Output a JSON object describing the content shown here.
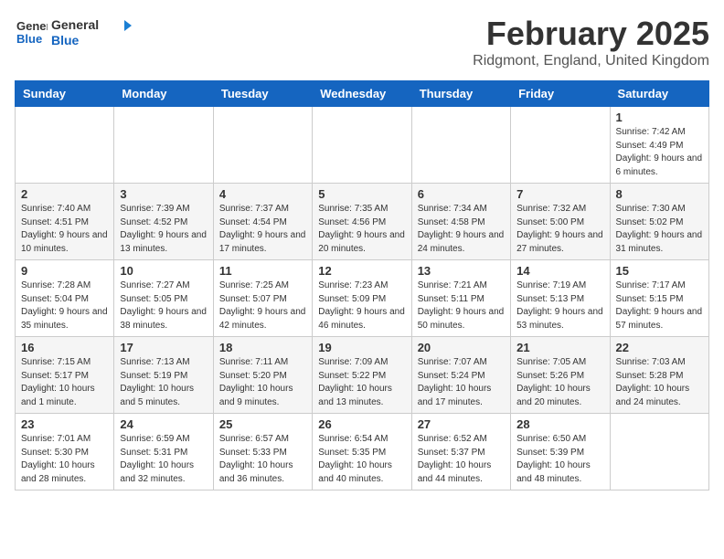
{
  "header": {
    "logo": {
      "line1": "General",
      "line2": "Blue"
    },
    "title": "February 2025",
    "subtitle": "Ridgmont, England, United Kingdom"
  },
  "weekdays": [
    "Sunday",
    "Monday",
    "Tuesday",
    "Wednesday",
    "Thursday",
    "Friday",
    "Saturday"
  ],
  "weeks": [
    [
      {
        "day": "",
        "info": ""
      },
      {
        "day": "",
        "info": ""
      },
      {
        "day": "",
        "info": ""
      },
      {
        "day": "",
        "info": ""
      },
      {
        "day": "",
        "info": ""
      },
      {
        "day": "",
        "info": ""
      },
      {
        "day": "1",
        "info": "Sunrise: 7:42 AM\nSunset: 4:49 PM\nDaylight: 9 hours and 6 minutes."
      }
    ],
    [
      {
        "day": "2",
        "info": "Sunrise: 7:40 AM\nSunset: 4:51 PM\nDaylight: 9 hours and 10 minutes."
      },
      {
        "day": "3",
        "info": "Sunrise: 7:39 AM\nSunset: 4:52 PM\nDaylight: 9 hours and 13 minutes."
      },
      {
        "day": "4",
        "info": "Sunrise: 7:37 AM\nSunset: 4:54 PM\nDaylight: 9 hours and 17 minutes."
      },
      {
        "day": "5",
        "info": "Sunrise: 7:35 AM\nSunset: 4:56 PM\nDaylight: 9 hours and 20 minutes."
      },
      {
        "day": "6",
        "info": "Sunrise: 7:34 AM\nSunset: 4:58 PM\nDaylight: 9 hours and 24 minutes."
      },
      {
        "day": "7",
        "info": "Sunrise: 7:32 AM\nSunset: 5:00 PM\nDaylight: 9 hours and 27 minutes."
      },
      {
        "day": "8",
        "info": "Sunrise: 7:30 AM\nSunset: 5:02 PM\nDaylight: 9 hours and 31 minutes."
      }
    ],
    [
      {
        "day": "9",
        "info": "Sunrise: 7:28 AM\nSunset: 5:04 PM\nDaylight: 9 hours and 35 minutes."
      },
      {
        "day": "10",
        "info": "Sunrise: 7:27 AM\nSunset: 5:05 PM\nDaylight: 9 hours and 38 minutes."
      },
      {
        "day": "11",
        "info": "Sunrise: 7:25 AM\nSunset: 5:07 PM\nDaylight: 9 hours and 42 minutes."
      },
      {
        "day": "12",
        "info": "Sunrise: 7:23 AM\nSunset: 5:09 PM\nDaylight: 9 hours and 46 minutes."
      },
      {
        "day": "13",
        "info": "Sunrise: 7:21 AM\nSunset: 5:11 PM\nDaylight: 9 hours and 50 minutes."
      },
      {
        "day": "14",
        "info": "Sunrise: 7:19 AM\nSunset: 5:13 PM\nDaylight: 9 hours and 53 minutes."
      },
      {
        "day": "15",
        "info": "Sunrise: 7:17 AM\nSunset: 5:15 PM\nDaylight: 9 hours and 57 minutes."
      }
    ],
    [
      {
        "day": "16",
        "info": "Sunrise: 7:15 AM\nSunset: 5:17 PM\nDaylight: 10 hours and 1 minute."
      },
      {
        "day": "17",
        "info": "Sunrise: 7:13 AM\nSunset: 5:19 PM\nDaylight: 10 hours and 5 minutes."
      },
      {
        "day": "18",
        "info": "Sunrise: 7:11 AM\nSunset: 5:20 PM\nDaylight: 10 hours and 9 minutes."
      },
      {
        "day": "19",
        "info": "Sunrise: 7:09 AM\nSunset: 5:22 PM\nDaylight: 10 hours and 13 minutes."
      },
      {
        "day": "20",
        "info": "Sunrise: 7:07 AM\nSunset: 5:24 PM\nDaylight: 10 hours and 17 minutes."
      },
      {
        "day": "21",
        "info": "Sunrise: 7:05 AM\nSunset: 5:26 PM\nDaylight: 10 hours and 20 minutes."
      },
      {
        "day": "22",
        "info": "Sunrise: 7:03 AM\nSunset: 5:28 PM\nDaylight: 10 hours and 24 minutes."
      }
    ],
    [
      {
        "day": "23",
        "info": "Sunrise: 7:01 AM\nSunset: 5:30 PM\nDaylight: 10 hours and 28 minutes."
      },
      {
        "day": "24",
        "info": "Sunrise: 6:59 AM\nSunset: 5:31 PM\nDaylight: 10 hours and 32 minutes."
      },
      {
        "day": "25",
        "info": "Sunrise: 6:57 AM\nSunset: 5:33 PM\nDaylight: 10 hours and 36 minutes."
      },
      {
        "day": "26",
        "info": "Sunrise: 6:54 AM\nSunset: 5:35 PM\nDaylight: 10 hours and 40 minutes."
      },
      {
        "day": "27",
        "info": "Sunrise: 6:52 AM\nSunset: 5:37 PM\nDaylight: 10 hours and 44 minutes."
      },
      {
        "day": "28",
        "info": "Sunrise: 6:50 AM\nSunset: 5:39 PM\nDaylight: 10 hours and 48 minutes."
      },
      {
        "day": "",
        "info": ""
      }
    ]
  ]
}
